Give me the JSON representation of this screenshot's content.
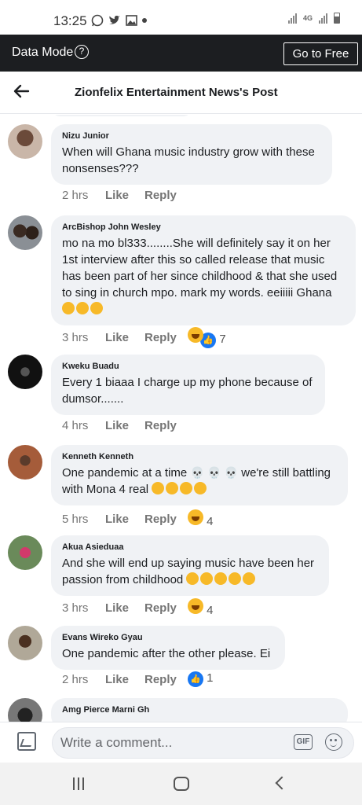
{
  "status_bar": {
    "time": "13:25",
    "network": "4G"
  },
  "data_bar": {
    "label": "Data Mode",
    "help_symbol": "?",
    "go_free_label": "Go to Free"
  },
  "header": {
    "title": "Zionfelix Entertainment News's Post"
  },
  "comments": [
    {
      "name": "Nizu Junior",
      "text": "When will Ghana music industry grow with these nonsenses???",
      "time": "2 hrs",
      "like": "Like",
      "reply": "Reply",
      "reaction_count": ""
    },
    {
      "name": "ArcBishop John Wesley",
      "text": "mo na mo bl333........She will definitely say it on her 1st interview after this so called release that music has been part of her since childhood & that she used to sing in church mpo. mark my words. eeiiiii Ghana",
      "time": "3 hrs",
      "like": "Like",
      "reply": "Reply",
      "reaction_count": "7"
    },
    {
      "name": "Kweku Buadu",
      "text": "Every 1 biaaa I charge up my phone because of dumsor.......",
      "time": "4 hrs",
      "like": "Like",
      "reply": "Reply",
      "reaction_count": ""
    },
    {
      "name": "Kenneth Kenneth",
      "text_part1": "One pandemic at a time",
      "text_part2": "we're still battling",
      "text_part3": "with Mona 4 real",
      "time": "5 hrs",
      "like": "Like",
      "reply": "Reply",
      "reaction_count": "4"
    },
    {
      "name": "Akua Asieduaa",
      "text": "And she will end up saying music have been her passion from childhood",
      "time": "3 hrs",
      "like": "Like",
      "reply": "Reply",
      "reaction_count": "4"
    },
    {
      "name": "Evans Wireko Gyau",
      "text": "One pandemic after the other please. Ei",
      "time": "2 hrs",
      "like": "Like",
      "reply": "Reply",
      "reaction_count": "1"
    },
    {
      "name": "Amg Pierce Marni Gh"
    }
  ],
  "composer": {
    "placeholder": "Write a comment...",
    "gif_label": "GIF"
  },
  "colors": {
    "dark_bar": "#1c1e21",
    "bubble": "#f0f2f5",
    "like_blue": "#1877f2",
    "haha_yellow": "#f7b928"
  },
  "icons": [
    "whatsapp-icon",
    "twitter-icon",
    "gallery-icon",
    "help-icon",
    "back-arrow-icon",
    "photo-icon",
    "gif-icon",
    "emoji-icon",
    "nav-recents-icon",
    "nav-home-icon",
    "nav-back-icon"
  ]
}
